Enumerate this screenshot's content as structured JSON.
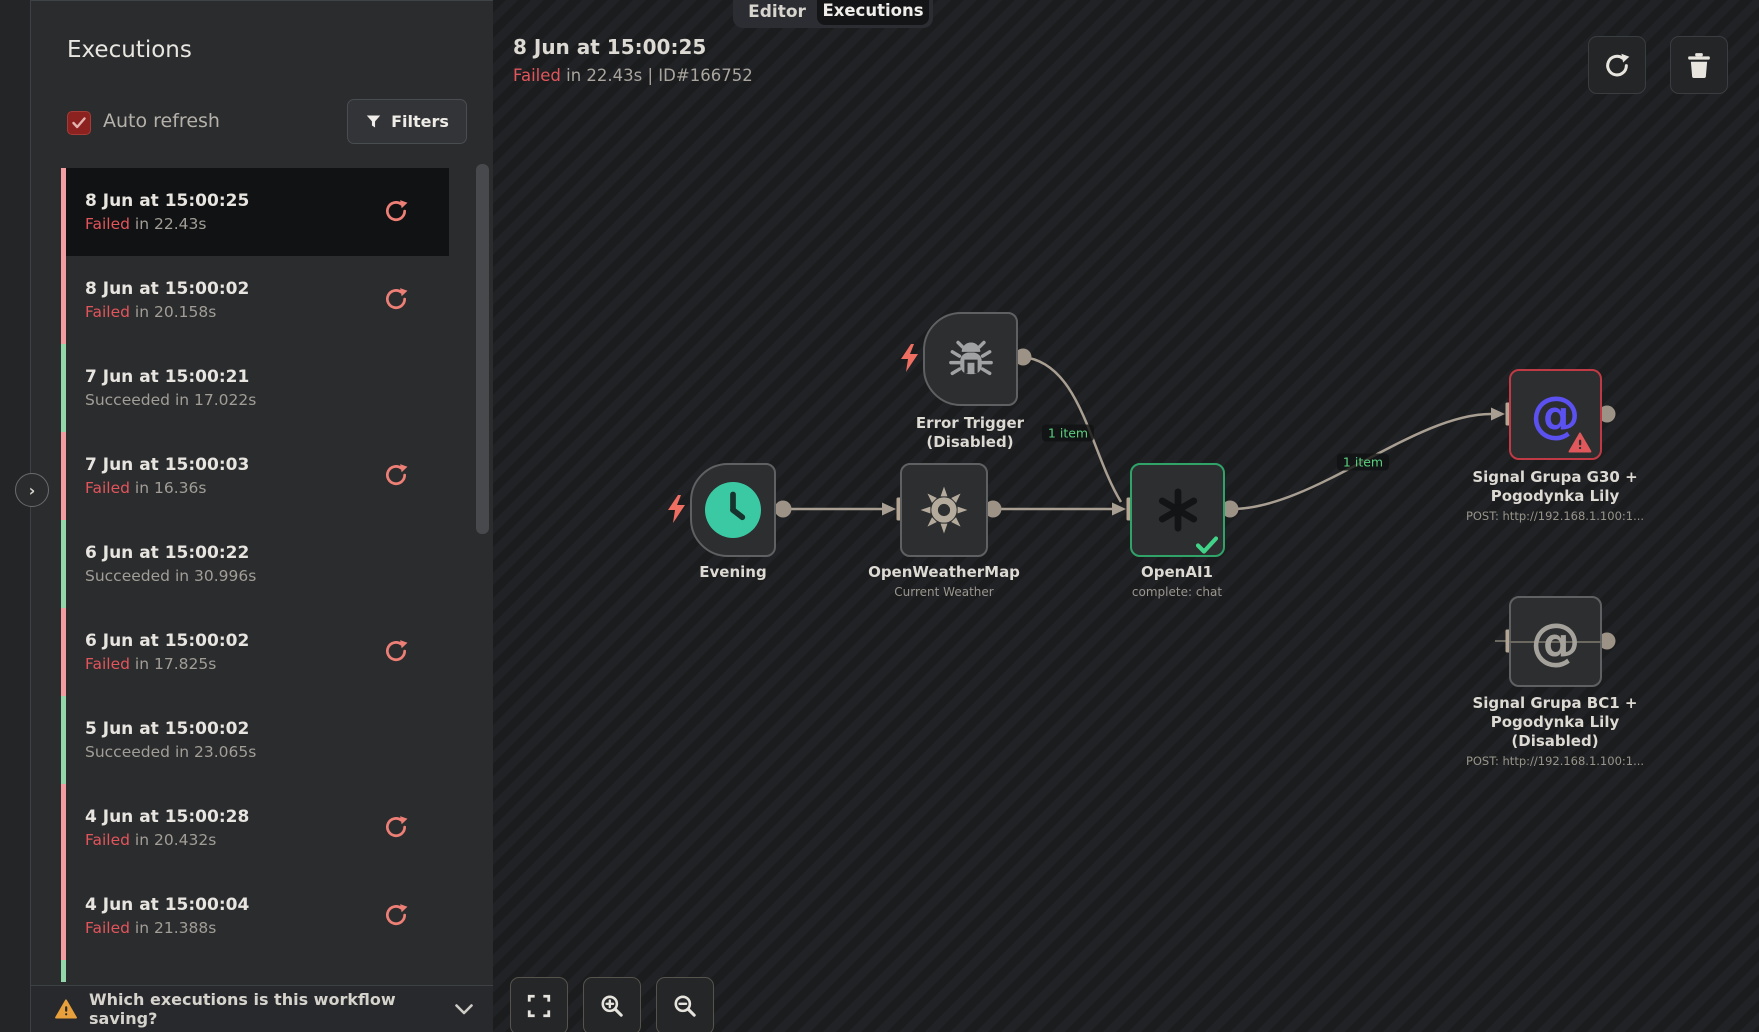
{
  "tabs": {
    "editor": "Editor",
    "executions": "Executions"
  },
  "sidebar": {
    "title": "Executions",
    "auto_refresh_label": "Auto refresh",
    "auto_refresh_checked": true,
    "filters_label": "Filters",
    "footer_question": "Which executions is this workflow saving?",
    "executions": [
      {
        "date": "8 Jun at 15:00:25",
        "status": "Failed",
        "duration": "in 22.43s",
        "outcome": "failed",
        "selected": true,
        "retry": true
      },
      {
        "date": "8 Jun at 15:00:02",
        "status": "Failed",
        "duration": "in 20.158s",
        "outcome": "failed",
        "retry": true
      },
      {
        "date": "7 Jun at 15:00:21",
        "status": "Succeeded",
        "duration": "in 17.022s",
        "outcome": "succeeded",
        "retry": false
      },
      {
        "date": "7 Jun at 15:00:03",
        "status": "Failed",
        "duration": "in 16.36s",
        "outcome": "failed",
        "retry": true
      },
      {
        "date": "6 Jun at 15:00:22",
        "status": "Succeeded",
        "duration": "in 30.996s",
        "outcome": "succeeded",
        "retry": false
      },
      {
        "date": "6 Jun at 15:00:02",
        "status": "Failed",
        "duration": "in 17.825s",
        "outcome": "failed",
        "retry": true
      },
      {
        "date": "5 Jun at 15:00:02",
        "status": "Succeeded",
        "duration": "in 23.065s",
        "outcome": "succeeded",
        "retry": false
      },
      {
        "date": "4 Jun at 15:00:28",
        "status": "Failed",
        "duration": "in 20.432s",
        "outcome": "failed",
        "retry": true
      },
      {
        "date": "4 Jun at 15:00:04",
        "status": "Failed",
        "duration": "in 21.388s",
        "outcome": "failed",
        "retry": true
      },
      {
        "partial": true,
        "outcome": "succeeded"
      }
    ]
  },
  "header": {
    "title": "8 Jun at 15:00:25",
    "status": "Failed",
    "duration": "in 22.43s | ID#166752"
  },
  "canvas": {
    "nodes": {
      "error_trigger": {
        "name": "Error Trigger",
        "sub": "(Disabled)"
      },
      "evening": {
        "name": "Evening"
      },
      "openweathermap": {
        "name": "OpenWeatherMap",
        "sub": "Current Weather"
      },
      "openai": {
        "name": "OpenAI1",
        "sub": "complete: chat"
      },
      "signal_g30": {
        "line1": "Signal Grupa G30 +",
        "line2": "Pogodynka Lily",
        "sub": "POST: http://192.168.1.100:1..."
      },
      "signal_bc1": {
        "line1": "Signal Grupa BC1 +",
        "line2": "Pogodynka Lily",
        "line3": "(Disabled)",
        "sub": "POST: http://192.168.1.100:1..."
      }
    },
    "edge_labels": {
      "items_1": "1 item",
      "items_2": "1 item"
    }
  },
  "colors": {
    "failed_red": "#e2555b",
    "failed_strip": "#f49da1",
    "succeeded_strip": "#93d6a9",
    "retry_salmon": "#ee7f76",
    "success_green": "#2fa368",
    "check_green": "#41d488",
    "error_border": "#bf3a44",
    "trigger_teal": "#3bc9a3",
    "at_purple": "#5b50f0",
    "edge_tan": "#a89f92",
    "warn_amber": "#e7a03c",
    "edge_item_green": "#5ad07e"
  }
}
